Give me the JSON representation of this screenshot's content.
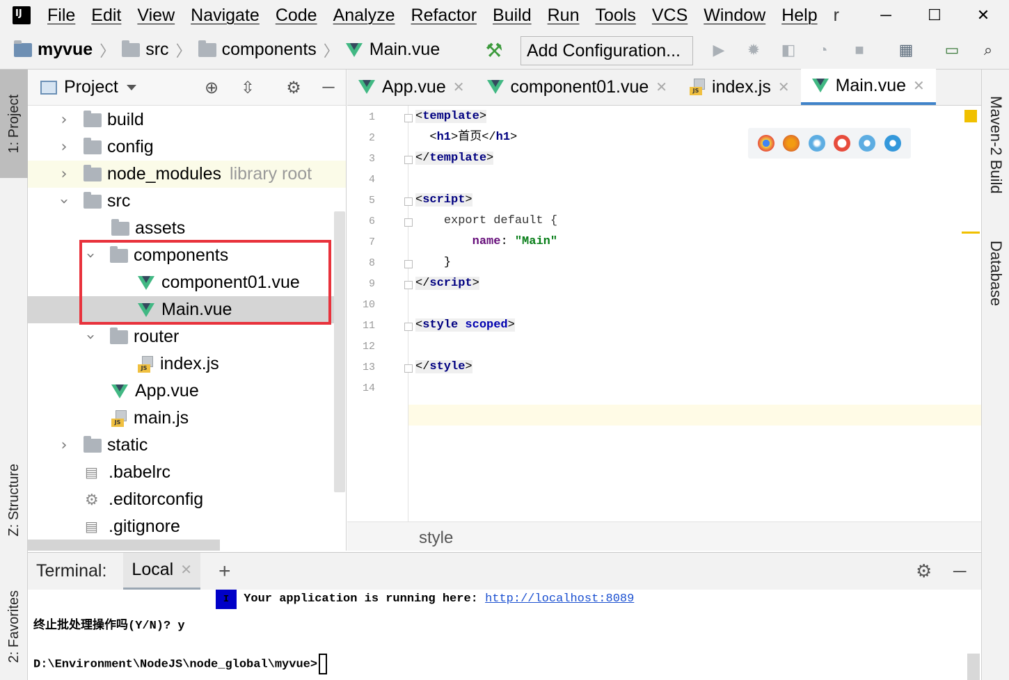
{
  "menu": {
    "items": [
      "File",
      "Edit",
      "View",
      "Navigate",
      "Code",
      "Analyze",
      "Refactor",
      "Build",
      "Run",
      "Tools",
      "VCS",
      "Window",
      "Help"
    ],
    "extra": "r",
    "minimize": "─",
    "maximize": "☐",
    "close": "✕"
  },
  "breadcrumb": {
    "project": "myvue",
    "folder1": "src",
    "folder2": "components",
    "file": "Main.vue"
  },
  "toolbar": {
    "add_configuration": "Add Configuration..."
  },
  "left_strip": {
    "project_tab": "1: Project",
    "structure_tab": "Z: Structure",
    "favorites_tab": "2: Favorites"
  },
  "right_strip": {
    "maven_tab": "Maven-2 Build",
    "database_tab": "Database"
  },
  "project_panel": {
    "title": "Project",
    "tree": [
      {
        "label": "build",
        "hint": ""
      },
      {
        "label": "config",
        "hint": ""
      },
      {
        "label": "node_modules",
        "hint": "library root"
      },
      {
        "label": "src",
        "hint": ""
      },
      {
        "label": "assets",
        "hint": ""
      },
      {
        "label": "components",
        "hint": ""
      },
      {
        "label": "component01.vue",
        "hint": ""
      },
      {
        "label": "Main.vue",
        "hint": ""
      },
      {
        "label": "router",
        "hint": ""
      },
      {
        "label": "index.js",
        "hint": ""
      },
      {
        "label": "App.vue",
        "hint": ""
      },
      {
        "label": "main.js",
        "hint": ""
      },
      {
        "label": "static",
        "hint": ""
      },
      {
        "label": ".babelrc",
        "hint": ""
      },
      {
        "label": ".editorconfig",
        "hint": ""
      },
      {
        "label": ".gitignore",
        "hint": ""
      }
    ]
  },
  "editor": {
    "tabs": [
      "App.vue",
      "component01.vue",
      "index.js",
      "Main.vue"
    ],
    "active_tab": "Main.vue",
    "line_numbers": [
      "1",
      "2",
      "3",
      "4",
      "5",
      "6",
      "7",
      "8",
      "9",
      "10",
      "11",
      "12",
      "13",
      "14"
    ],
    "breadcrumb": "style",
    "code": {
      "l1": "template",
      "l2_open": "h1",
      "l2_text": "首页",
      "l2_close": "h1",
      "l3": "template",
      "l5": "script",
      "l6": "export default {",
      "l7_key": "name",
      "l7_val": "\"Main\"",
      "l8": "}",
      "l9": "script",
      "l11_tag": "style",
      "l11_attr": "scoped",
      "l13": "style"
    }
  },
  "terminal": {
    "label": "Terminal:",
    "tab": "Local",
    "add": "+",
    "line1_marker": "I",
    "line1_text": " Your application is running here: ",
    "line1_link": "http://localhost:8089",
    "line2": "终止批处理操作吗(Y/N)? y",
    "line3": "D:\\Environment\\NodeJS\\node_global\\myvue>"
  }
}
